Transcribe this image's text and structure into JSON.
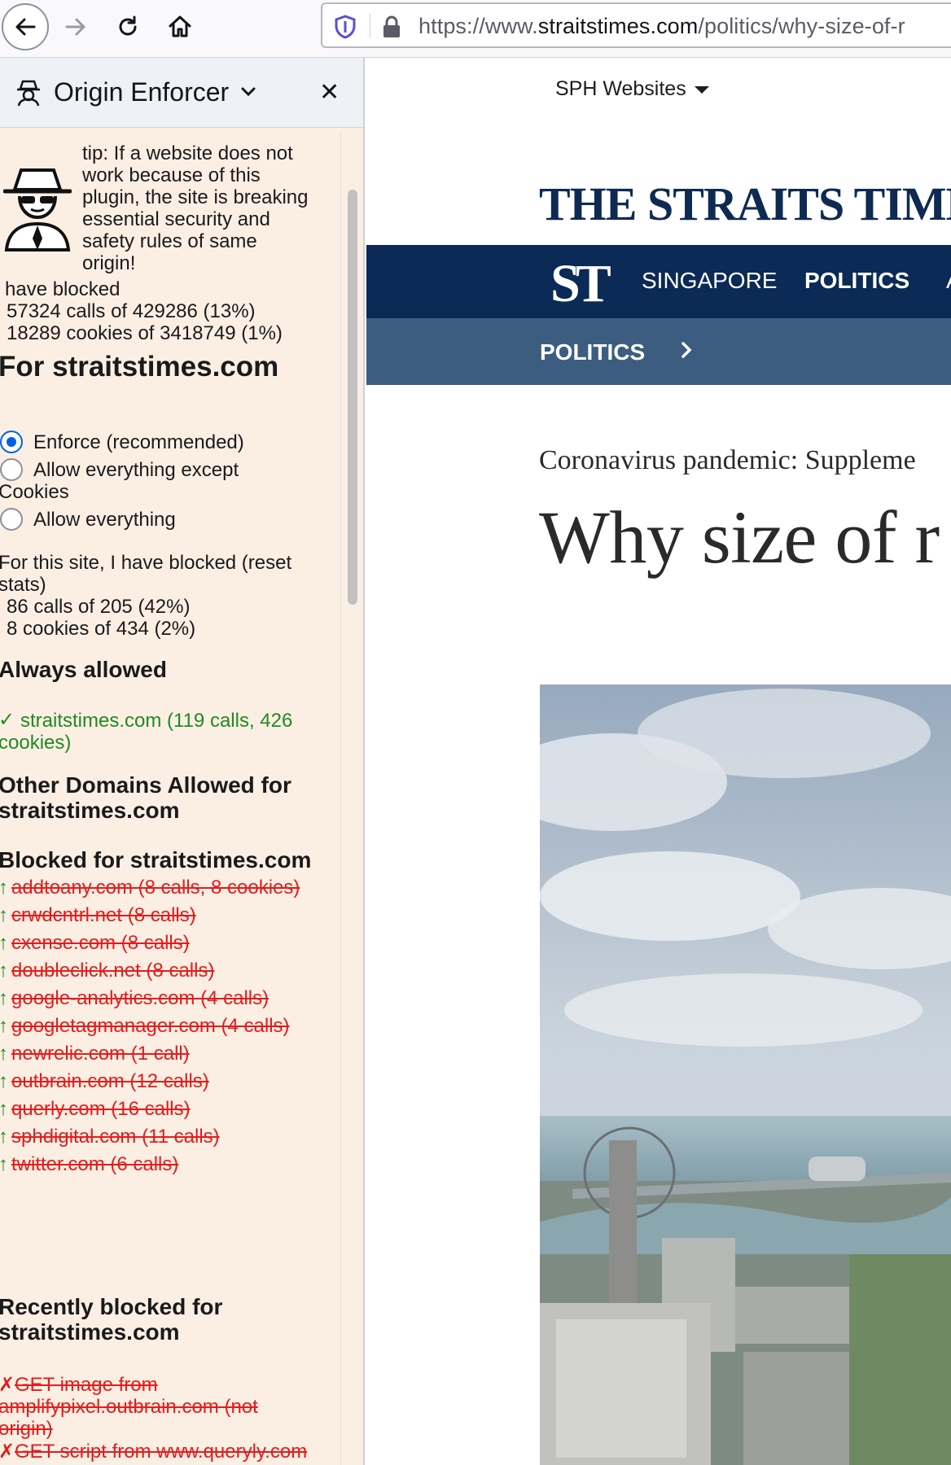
{
  "browser": {
    "url_prefix": "https://www.",
    "url_host": "straitstimes.com",
    "url_path": "/politics/why-size-of-r",
    "icons": [
      "back-arrow-icon",
      "forward-arrow-icon",
      "reload-icon",
      "home-icon",
      "shield-icon",
      "lock-icon"
    ]
  },
  "sidebar": {
    "title": "Origin Enforcer",
    "tip": [
      "tip: If a website does not",
      "work because of this",
      "plugin, the site is breaking",
      "essential security and",
      "safety rules of same",
      "origin!"
    ],
    "global_stats": {
      "intro": "have blocked",
      "calls": "57324 calls of 429286 (13%)",
      "cookies": "18289 cookies of 3418749 (1%)"
    },
    "site_heading": "For straitstimes.com",
    "modes": {
      "enforce": "Enforce (recommended)",
      "allow_except_line1": "Allow everything except",
      "allow_except_line2": "Cookies",
      "allow_all": "Allow everything",
      "selected": "enforce"
    },
    "site_stats": {
      "line1": "For this site, I have blocked (reset",
      "line2": "stats)",
      "calls": "86 calls of 205 (42%)",
      "cookies": "8 cookies of 434 (2%)"
    },
    "always_allowed": {
      "heading": "Always allowed",
      "mark": "✓",
      "line1": "straitstimes.com (119 calls, 426",
      "line2": "cookies)"
    },
    "other_allowed_heading": [
      "Other Domains Allowed for",
      "straitstimes.com"
    ],
    "blocked_heading": "Blocked for straitstimes.com",
    "blocked_mark": "↑",
    "blocked": [
      "addtoany.com (8 calls, 8 cookies)",
      "crwdcntrl.net (8 calls)",
      "cxense.com (8 calls)",
      "doubleclick.net (8 calls)",
      "google-analytics.com (4 calls)",
      "googletagmanager.com (4 calls)",
      "newrelic.com (1 call)",
      "outbrain.com (12 calls)",
      "querly.com (16 calls)",
      "sphdigital.com (11 calls)",
      "twitter.com (6 calls)"
    ],
    "recent_heading": [
      "Recently blocked for",
      "straitstimes.com"
    ],
    "recent_mark": "✗",
    "recent": [
      {
        "lines": [
          "GET image from",
          "amplifypixel.outbrain.com (not",
          "origin)"
        ]
      },
      {
        "lines": [
          "GET script from www.queryly.com"
        ]
      }
    ]
  },
  "page": {
    "sph_label": "SPH Websites",
    "masthead": "THE STRAITS TIMES",
    "logo": "ST",
    "nav": [
      "SINGAPORE",
      "POLITICS",
      "A"
    ],
    "subnav": "POLITICS",
    "kicker": "Coronavirus pandemic: Suppleme",
    "headline": "Why size of r",
    "colors": {
      "navy": "#0b2a55",
      "subnav": "#3c5d80",
      "sidebar_bg": "#fbefe4",
      "blocked_red": "#e51c1c",
      "allowed_green": "#218a21"
    }
  }
}
